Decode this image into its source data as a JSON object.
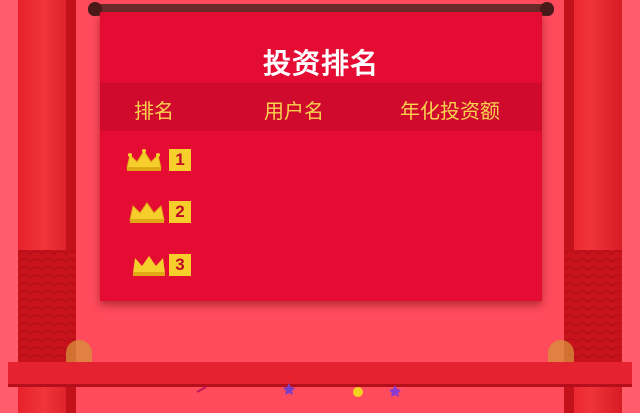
{
  "board": {
    "title": "投资排名",
    "columns": [
      "排名",
      "用户名",
      "年化投资额"
    ]
  },
  "rows": [
    {
      "rank": "1",
      "icon": "gold-crown-icon",
      "username": "",
      "amount": ""
    },
    {
      "rank": "2",
      "icon": "gold-crown-icon",
      "username": "",
      "amount": ""
    },
    {
      "rank": "3",
      "icon": "gold-crown-icon",
      "username": "",
      "amount": ""
    }
  ],
  "colors": {
    "background": "#ff4b5c",
    "panel": "#e50c34",
    "header_row": "#cf0a2d",
    "accent_gold": "#f9d24e",
    "title_text": "#ffffff"
  }
}
